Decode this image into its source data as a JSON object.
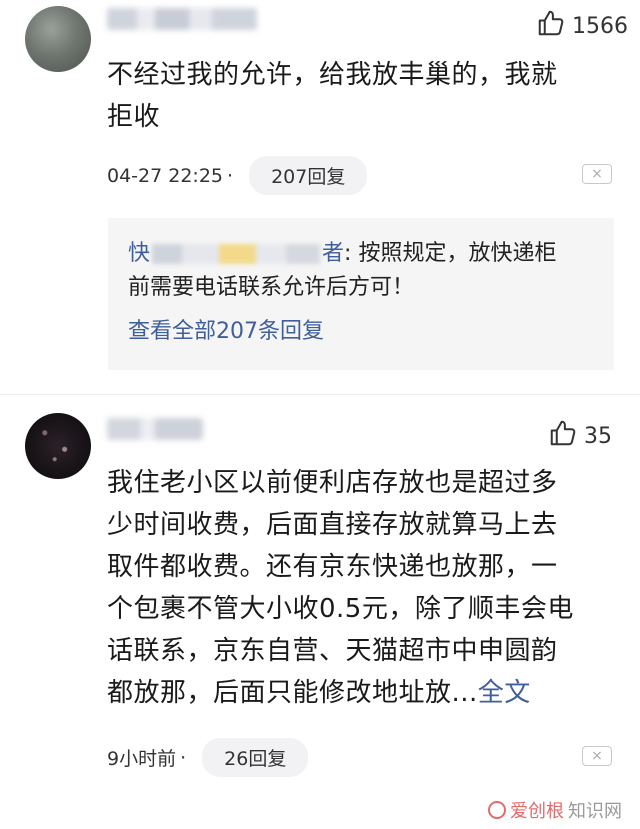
{
  "comments": [
    {
      "likes": "1566",
      "text_line1": "不经过我的允许，给我放丰巢的，我就",
      "text_line2": "拒收",
      "time": "04-27 22:25",
      "dot": "·",
      "replies_label": "207回复",
      "nested_reply": {
        "author_start": "快",
        "author_end": "者",
        "colon": ":",
        "line1": "按照规定，放快递柜",
        "line2": "前需要电话联系允许后方可！",
        "view_all": "查看全部207条回复"
      }
    },
    {
      "likes": "35",
      "lines": [
        "我住老小区以前便利店存放也是超过多",
        "少时间收费，后面直接存放就算马上去",
        "取件都收费。还有京东快递也放那，一",
        "个包裹不管大小收0.5元，除了顺丰会电",
        "话联系，京东自营、天猫超市中申圆韵"
      ],
      "last_line": "都放那，后面只能修改地址放...",
      "full_text_link": "全文",
      "time": "9小时前",
      "dot": "·",
      "replies_label": "26回复"
    }
  ],
  "close_glyph": "×",
  "watermark": {
    "brand": "爱创根",
    "site": "知识网"
  },
  "icons": [
    "thumbs-up-icon",
    "close-icon",
    "watermark-logo-icon"
  ],
  "colors": {
    "link": "#3f5f9c",
    "reply_bg": "#f5f5f5",
    "pill_bg": "#f2f2f4"
  }
}
